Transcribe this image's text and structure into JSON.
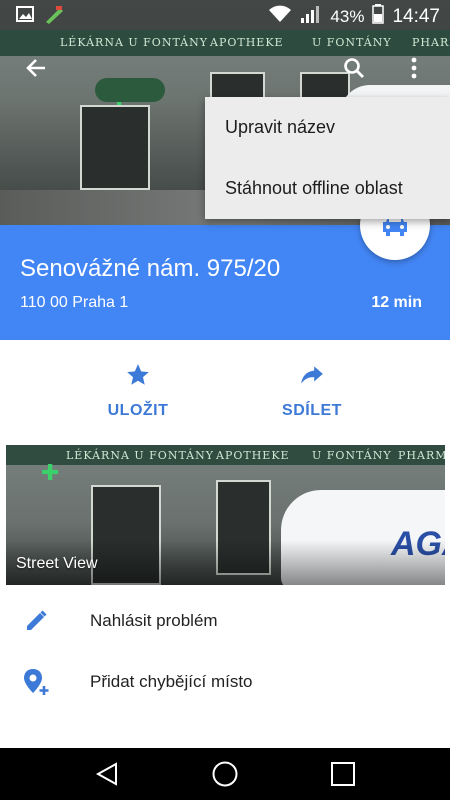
{
  "status_bar": {
    "battery_percent": "43%",
    "time": "14:47"
  },
  "hero": {
    "facade_texts": [
      "LÉKÁRNA U FONTÁNY",
      "APOTHEKE",
      "U FONTÁNY",
      "PHARMA"
    ]
  },
  "menu": {
    "items": [
      {
        "label": "Upravit název"
      },
      {
        "label": "Stáhnout offline oblast"
      }
    ]
  },
  "place": {
    "title": "Senovážné nám. 975/20",
    "subtitle": "110 00 Praha 1",
    "travel_time": "12 min"
  },
  "actions": {
    "save_label": "ULOŽIT",
    "share_label": "SDÍLET"
  },
  "street_view": {
    "label": "Street View",
    "van_text": "AGA"
  },
  "list": {
    "report_label": "Nahlásit problém",
    "add_place_label": "Přidat chybějící místo"
  },
  "colors": {
    "accent_blue": "#4285f4",
    "action_blue": "#3d79d6"
  }
}
